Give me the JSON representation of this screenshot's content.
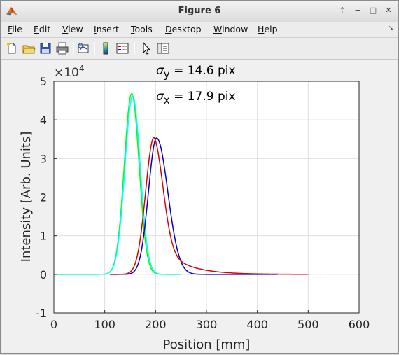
{
  "window": {
    "title": "Figure 6"
  },
  "menu": [
    {
      "label": "File",
      "u": "F",
      "rest": "ile"
    },
    {
      "label": "Edit",
      "u": "E",
      "rest": "dit"
    },
    {
      "label": "View",
      "u": "V",
      "rest": "iew"
    },
    {
      "label": "Insert",
      "u": "I",
      "rest": "nsert"
    },
    {
      "label": "Tools",
      "u": "T",
      "rest": "ools"
    },
    {
      "label": "Desktop",
      "u": "D",
      "rest": "esktop"
    },
    {
      "label": "Window",
      "u": "W",
      "rest": "indow"
    },
    {
      "label": "Help",
      "u": "H",
      "rest": "elp"
    }
  ],
  "toolbar_icons": [
    "new-figure-icon",
    "open-file-icon",
    "save-icon",
    "print-icon",
    "link-plot-icon",
    "insert-colorbar-icon",
    "insert-legend-icon",
    "pointer-icon",
    "property-inspector-icon"
  ],
  "chart_data": {
    "type": "line",
    "xlabel": "Position [mm]",
    "ylabel": "Intensity [Arb. Units]",
    "xlim": [
      0,
      600
    ],
    "ylim": [
      -1,
      5
    ],
    "y_exponent_label": "×10",
    "y_exponent_power": "4",
    "xticks": [
      0,
      100,
      200,
      300,
      400,
      500,
      600
    ],
    "yticks": [
      -1,
      0,
      1,
      2,
      3,
      4,
      5
    ],
    "grid": true,
    "annotations": [
      {
        "sym": "σ",
        "sub": "y",
        "text": " = 14.6 pix"
      },
      {
        "sym": "σ",
        "sub": "x",
        "text": " = 17.9 pix"
      }
    ],
    "series": [
      {
        "color": "#00ff00",
        "x0": 0,
        "x1": 250,
        "peak_x": 153,
        "peak_y": 4.68,
        "sigma_left": 14.6,
        "sigma_right": 14.6
      },
      {
        "color": "#00ffff",
        "x0": 0,
        "x1": 250,
        "peak_x": 155,
        "peak_y": 4.62,
        "sigma_left": 15.2,
        "sigma_right": 14.8
      },
      {
        "color": "#0000cc",
        "x0": 110,
        "x1": 440,
        "peak_x": 202,
        "peak_y": 3.53,
        "sigma_left": 16.0,
        "sigma_right": 22.0
      },
      {
        "color": "#dd0000",
        "x0": 110,
        "x1": 500,
        "peak_x": 197,
        "peak_y": 3.55,
        "sigma_left": 16.5,
        "sigma_right": 17.9,
        "tail": 46
      }
    ]
  }
}
